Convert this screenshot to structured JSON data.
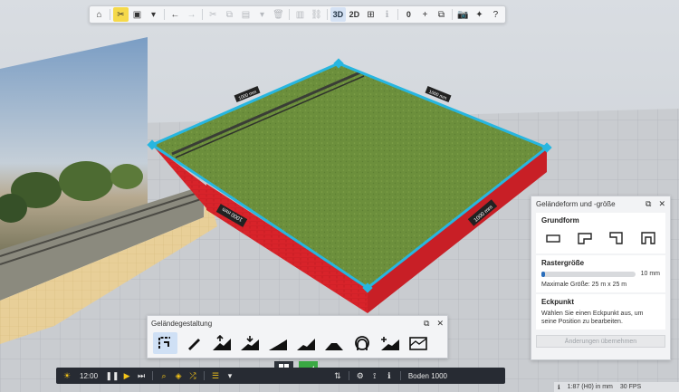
{
  "toolbar": {
    "items": [
      {
        "name": "home-button",
        "icon": "⌂",
        "type": "btn"
      },
      {
        "name": "sep"
      },
      {
        "name": "terrain-tools-button",
        "icon": "✂",
        "type": "btn",
        "state": "yellow"
      },
      {
        "name": "save-button",
        "icon": "▣",
        "type": "btn"
      },
      {
        "name": "save-dropdown-button",
        "icon": "▾",
        "type": "btn"
      },
      {
        "name": "sep"
      },
      {
        "name": "undo-button",
        "icon": "←",
        "type": "btn"
      },
      {
        "name": "redo-button",
        "icon": "→",
        "type": "btn",
        "state": "disabled"
      },
      {
        "name": "sep"
      },
      {
        "name": "cut-button",
        "icon": "✂",
        "type": "btn",
        "state": "disabled"
      },
      {
        "name": "copy-button",
        "icon": "⧉",
        "type": "btn",
        "state": "disabled"
      },
      {
        "name": "paste-button",
        "icon": "▤",
        "type": "btn",
        "state": "disabled"
      },
      {
        "name": "paste-dropdown-button",
        "icon": "▾",
        "type": "btn",
        "state": "disabled"
      },
      {
        "name": "delete-button",
        "icon": "🗑",
        "type": "btn",
        "state": "disabled"
      },
      {
        "name": "sep"
      },
      {
        "name": "group-button",
        "icon": "▥",
        "type": "btn",
        "state": "disabled"
      },
      {
        "name": "link-button",
        "icon": "⛓",
        "type": "btn",
        "state": "disabled"
      },
      {
        "name": "sep"
      },
      {
        "name": "view-3d-button",
        "label": "3D",
        "type": "text",
        "state": "blue"
      },
      {
        "name": "view-2d-button",
        "label": "2D",
        "type": "text"
      },
      {
        "name": "grid-button",
        "icon": "⊞",
        "type": "btn"
      },
      {
        "name": "info-small-button",
        "icon": "ℹ",
        "type": "btn",
        "state": "disabled"
      },
      {
        "name": "sep"
      },
      {
        "name": "count-zero-button",
        "label": "0",
        "type": "text"
      },
      {
        "name": "add-button",
        "icon": "+",
        "type": "btn"
      },
      {
        "name": "layers-button",
        "icon": "⧉",
        "type": "btn"
      },
      {
        "name": "sep"
      },
      {
        "name": "camera-button",
        "icon": "📷",
        "type": "btn"
      },
      {
        "name": "plugin-button",
        "icon": "✦",
        "type": "btn"
      },
      {
        "name": "help-button",
        "icon": "?",
        "type": "btn"
      }
    ]
  },
  "panel": {
    "title": "Geländeform und -größe",
    "grundform_title": "Grundform",
    "raster_title": "Rastergröße",
    "raster_value": "10 mm",
    "raster_fraction": 0.04,
    "max_size_text": "Maximale Größe: 25 m x 25 m",
    "eckpunkt_title": "Eckpunkt",
    "eckpunkt_text": "Wählen Sie einen Eckpunkt aus, um seine Position zu bearbeiten.",
    "apply_label": "Änderungen übernehmen"
  },
  "design": {
    "title": "Geländegestaltung",
    "tools": [
      "terrain-shape-tool",
      "paint-tool",
      "raise-tool",
      "lower-tool",
      "smooth-tool",
      "flatten-tool",
      "plateau-tool",
      "tunnel-portal-tool",
      "add-terrain-tool",
      "texture-tool"
    ]
  },
  "bottom": {
    "time": "12:00",
    "layer_label": "Boden 1000"
  },
  "status": {
    "scale": "1:87 (H0) in mm",
    "fps": "30 FPS"
  },
  "scene_labels": {
    "edge_left": "1000 mm",
    "edge_right": "1000 mm",
    "edge_back_left": "1000 mm",
    "edge_back_right": "1000 mm"
  },
  "colors": {
    "accent_blue": "#2a6ebb",
    "selection_cyan": "#27b6e0",
    "active_yellow": "#f5d94a",
    "terrain_red": "#d8232a",
    "grass_green": "#6c8f3c",
    "mode_green": "#3aa843"
  }
}
